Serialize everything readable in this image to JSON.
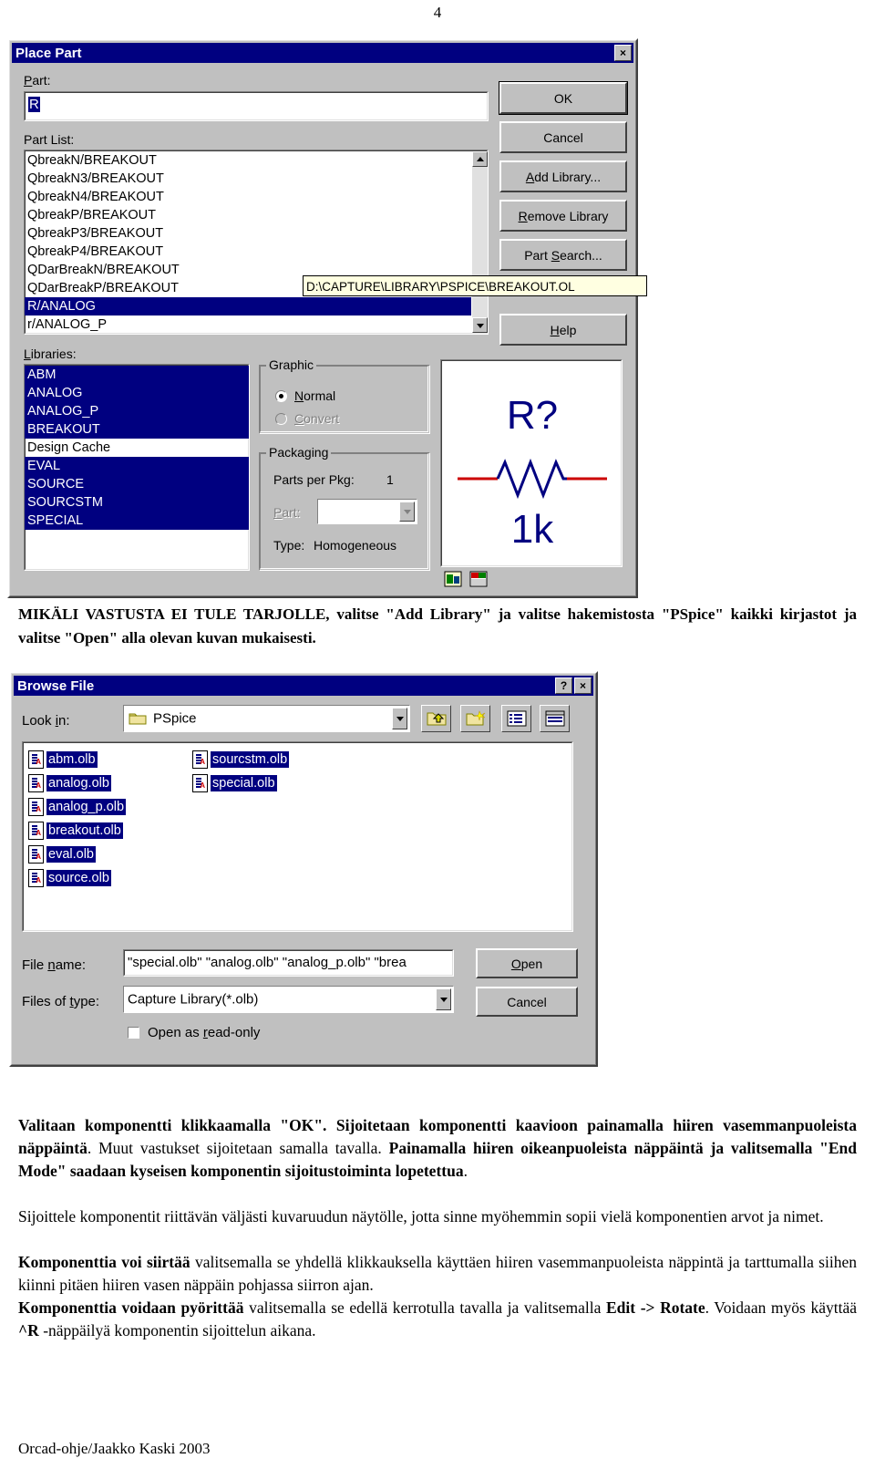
{
  "page": {
    "number": "4",
    "footer": "Orcad-ohje/Jaakko Kaski 2003"
  },
  "place_part_dialog": {
    "title": "Place Part",
    "close_label": "×",
    "part_label": "Part:",
    "part_value": "R",
    "part_list_label": "Part List:",
    "part_list": [
      "QbreakN/BREAKOUT",
      "QbreakN3/BREAKOUT",
      "QbreakN4/BREAKOUT",
      "QbreakP/BREAKOUT",
      "QbreakP3/BREAKOUT",
      "QbreakP4/BREAKOUT",
      "QDarBreakN/BREAKOUT",
      "QDarBreakP/BREAKOUT",
      "R/ANALOG",
      "r/ANALOG_P"
    ],
    "part_list_selected_index": 8,
    "tooltip": "D:\\CAPTURE\\LIBRARY\\PSPICE\\BREAKOUT.OL",
    "libraries_label": "Libraries:",
    "libraries": [
      {
        "name": "ABM",
        "selected": true
      },
      {
        "name": "ANALOG",
        "selected": true
      },
      {
        "name": "ANALOG_P",
        "selected": true
      },
      {
        "name": "BREAKOUT",
        "selected": true
      },
      {
        "name": "Design Cache",
        "selected": false
      },
      {
        "name": "EVAL",
        "selected": true
      },
      {
        "name": "SOURCE",
        "selected": true
      },
      {
        "name": "SOURCSTM",
        "selected": true
      },
      {
        "name": "SPECIAL",
        "selected": true
      }
    ],
    "graphic_group": "Graphic",
    "graphic_normal": "Normal",
    "graphic_convert": "Convert",
    "graphic_selected": "Normal",
    "packaging_group": "Packaging",
    "parts_per_pkg_label": "Parts per Pkg:",
    "parts_per_pkg_value": "1",
    "part_combo_label": "Part:",
    "part_combo_value": "",
    "type_label": "Type:",
    "type_value": "Homogeneous",
    "preview": {
      "ref": "R?",
      "value": "1k",
      "symbol_color": "#000080",
      "lead_color": "#cc0000"
    },
    "buttons": {
      "ok": "OK",
      "cancel": "Cancel",
      "add_library": "Add Library...",
      "remove_library": "Remove Library",
      "part_search": "Part Search...",
      "help": "Help"
    }
  },
  "instruction_1": "MIKÄLI VASTUSTA EI TULE TARJOLLE,  valitse \"Add Library\" ja valitse hakemistosta \"PSpice\" kaikki kirjastot ja valitse \"Open\" alla olevan kuvan mukaisesti.",
  "browse_dialog": {
    "title": "Browse File",
    "help_label": "?",
    "close_label": "×",
    "look_in_label": "Look in:",
    "look_in_value": "PSpice",
    "toolbar_icons": [
      "up-one-level-icon",
      "new-folder-icon",
      "list-view-icon",
      "details-view-icon"
    ],
    "files_col1": [
      "abm.olb",
      "analog.olb",
      "analog_p.olb",
      "breakout.olb",
      "eval.olb",
      "source.olb"
    ],
    "files_col2": [
      "sourcstm.olb",
      "special.olb"
    ],
    "focused_file": "special.olb",
    "file_name_label": "File name:",
    "file_name_value": "\"special.olb\" \"analog.olb\" \"analog_p.olb\" \"brea",
    "files_of_type_label": "Files of type:",
    "files_of_type_value": "Capture Library(*.olb)",
    "read_only_label": "Open as read-only",
    "read_only_checked": false,
    "open_button": "Open",
    "cancel_button": "Cancel"
  },
  "body_text": {
    "p1_a": "Valitaan komponentti klikkaamalla \"OK\". Sijoitetaan komponentti kaavioon painamalla hiiren vasemmanpuoleista näppäintä",
    "p1_b": ". Muut   vastukset sijoitetaan samalla tavalla. ",
    "p1_c": "Painamalla hiiren oikeanpuoleista näppäintä ja valitsemalla \"End Mode\" saadaan kyseisen komponentin sijoitustoiminta lopetettua",
    "p1_d": ".",
    "p2": "Sijoittele komponentit riittävän väljästi kuvaruudun näytölle, jotta sinne myöhemmin sopii vielä komponentien arvot ja nimet.",
    "p3_bold": "Komponenttia voi siirtää",
    "p3_rest": " valitsemalla se yhdellä klikkauksella käyttäen hiiren vasemmanpuoleista näppintä ja tarttumalla siihen kiinni pitäen hiiren vasen näppäin pohjassa siirron ajan.",
    "p4_bold": "Komponenttia voidaan pyörittää",
    "p4_mid": " valitsemalla se edellä kerrotulla tavalla ja valitsemalla ",
    "p4_bold2": "Edit -> Rotate",
    "p4_rest": ". Voidaan myös käyttää ",
    "p4_bold3": "^R",
    "p4_end": " -näppäilyä komponentin sijoittelun aikana."
  }
}
